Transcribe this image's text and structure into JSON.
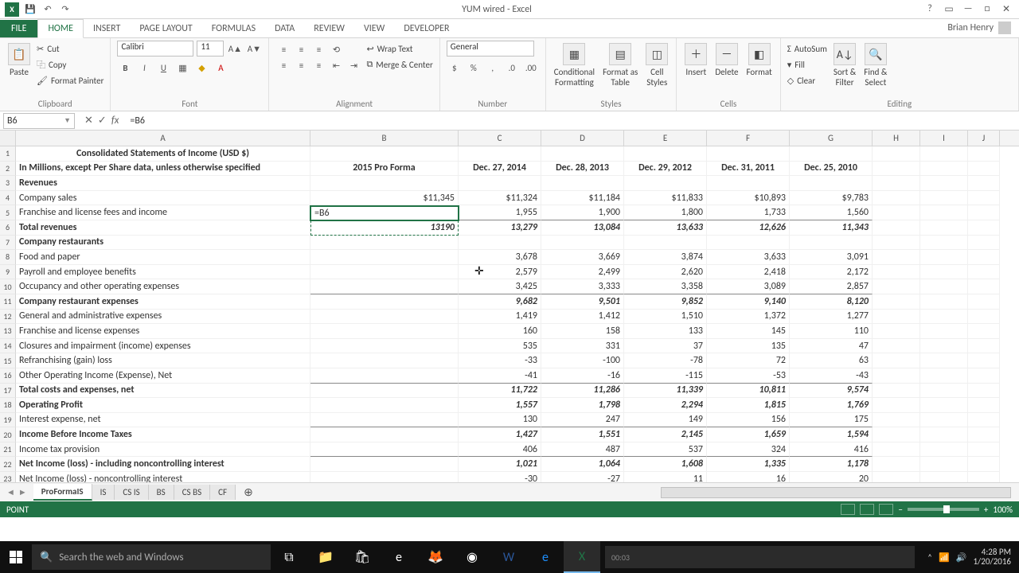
{
  "app": {
    "title": "YUM wired - Excel",
    "user": "Brian Henry"
  },
  "tabs": {
    "file": "FILE",
    "list": [
      "HOME",
      "INSERT",
      "PAGE LAYOUT",
      "FORMULAS",
      "DATA",
      "REVIEW",
      "VIEW",
      "DEVELOPER"
    ],
    "active": 0
  },
  "ribbon": {
    "clipboard": {
      "paste": "Paste",
      "cut": "Cut",
      "copy": "Copy",
      "fp": "Format Painter",
      "label": "Clipboard"
    },
    "font": {
      "name": "Calibri",
      "size": "11",
      "label": "Font"
    },
    "align": {
      "wrap": "Wrap Text",
      "merge": "Merge & Center",
      "label": "Alignment"
    },
    "number": {
      "fmt": "General",
      "label": "Number"
    },
    "styles": {
      "cf": "Conditional\nFormatting",
      "fat": "Format as\nTable",
      "cs": "Cell\nStyles",
      "label": "Styles"
    },
    "cells": {
      "ins": "Insert",
      "del": "Delete",
      "fmt": "Format",
      "label": "Cells"
    },
    "editing": {
      "sum": "AutoSum",
      "fill": "Fill",
      "clear": "Clear",
      "sort": "Sort &\nFilter",
      "find": "Find &\nSelect",
      "label": "Editing"
    }
  },
  "fbar": {
    "name": "B6",
    "formula": "=B6"
  },
  "cols": [
    "A",
    "B",
    "C",
    "D",
    "E",
    "F",
    "G",
    "H",
    "I",
    "J"
  ],
  "sheet": {
    "b5_edit": "=B6",
    "r1": {
      "a": "Consolidated Statements of Income (USD $)"
    },
    "r2": {
      "a": "In Millions, except Per Share data, unless otherwise specified",
      "b": "2015 Pro Forma",
      "c": "Dec. 27, 2014",
      "d": "Dec. 28, 2013",
      "e": "Dec. 29, 2012",
      "f": "Dec. 31, 2011",
      "g": "Dec. 25, 2010"
    },
    "r3": {
      "a": "Revenues"
    },
    "r4": {
      "a": "Company sales",
      "b": "$11,345",
      "c": "$11,324",
      "d": "$11,184",
      "e": "$11,833",
      "f": "$10,893",
      "g": "$9,783"
    },
    "r5": {
      "a": "Franchise and license fees and income",
      "c": "1,955",
      "d": "1,900",
      "e": "1,800",
      "f": "1,733",
      "g": "1,560"
    },
    "r6": {
      "a": "Total revenues",
      "b": "13190",
      "c": "13,279",
      "d": "13,084",
      "e": "13,633",
      "f": "12,626",
      "g": "11,343"
    },
    "r7": {
      "a": "Company restaurants"
    },
    "r8": {
      "a": "Food and paper",
      "c": "3,678",
      "d": "3,669",
      "e": "3,874",
      "f": "3,633",
      "g": "3,091"
    },
    "r9": {
      "a": "Payroll and employee benefits",
      "c": "2,579",
      "d": "2,499",
      "e": "2,620",
      "f": "2,418",
      "g": "2,172"
    },
    "r10": {
      "a": "Occupancy and other operating expenses",
      "c": "3,425",
      "d": "3,333",
      "e": "3,358",
      "f": "3,089",
      "g": "2,857"
    },
    "r11": {
      "a": "Company restaurant expenses",
      "c": "9,682",
      "d": "9,501",
      "e": "9,852",
      "f": "9,140",
      "g": "8,120"
    },
    "r12": {
      "a": "General and administrative expenses",
      "c": "1,419",
      "d": "1,412",
      "e": "1,510",
      "f": "1,372",
      "g": "1,277"
    },
    "r13": {
      "a": "Franchise and license expenses",
      "c": "160",
      "d": "158",
      "e": "133",
      "f": "145",
      "g": "110"
    },
    "r14": {
      "a": "Closures and impairment (income) expenses",
      "c": "535",
      "d": "331",
      "e": "37",
      "f": "135",
      "g": "47"
    },
    "r15": {
      "a": "Refranchising (gain) loss",
      "c": "-33",
      "d": "-100",
      "e": "-78",
      "f": "72",
      "g": "63"
    },
    "r16": {
      "a": "Other Operating Income (Expense), Net",
      "c": "-41",
      "d": "-16",
      "e": "-115",
      "f": "-53",
      "g": "-43"
    },
    "r17": {
      "a": "Total costs and expenses, net",
      "c": "11,722",
      "d": "11,286",
      "e": "11,339",
      "f": "10,811",
      "g": "9,574"
    },
    "r18": {
      "a": "Operating Profit",
      "c": "1,557",
      "d": "1,798",
      "e": "2,294",
      "f": "1,815",
      "g": "1,769"
    },
    "r19": {
      "a": "Interest expense, net",
      "c": "130",
      "d": "247",
      "e": "149",
      "f": "156",
      "g": "175"
    },
    "r20": {
      "a": "Income Before Income Taxes",
      "c": "1,427",
      "d": "1,551",
      "e": "2,145",
      "f": "1,659",
      "g": "1,594"
    },
    "r21": {
      "a": "Income tax provision",
      "c": "406",
      "d": "487",
      "e": "537",
      "f": "324",
      "g": "416"
    },
    "r22": {
      "a": "Net Income (loss) - including noncontrolling interest",
      "c": "1,021",
      "d": "1,064",
      "e": "1,608",
      "f": "1,335",
      "g": "1,178"
    },
    "r23": {
      "a": "Net Income (loss) - noncontrolling interest",
      "c": "-30",
      "d": "-27",
      "e": "11",
      "f": "16",
      "g": "20"
    }
  },
  "sheetTabs": {
    "list": [
      "ProFormaIS",
      "IS",
      "CS IS",
      "BS",
      "CS BS",
      "CF"
    ],
    "active": 0
  },
  "status": {
    "mode": "POINT",
    "zoom": "100%"
  },
  "taskbar": {
    "search": "Search the web and Windows",
    "timer": "00:03",
    "time": "4:28 PM",
    "date": "1/20/2016"
  }
}
